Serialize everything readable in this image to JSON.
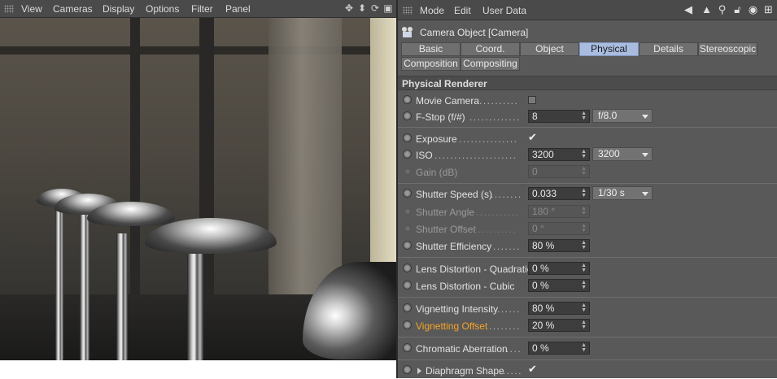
{
  "viewport": {
    "menu": [
      "View",
      "Cameras",
      "Display",
      "Options",
      "Filter",
      "Panel"
    ],
    "tools": [
      "move-icon",
      "down-arrow-icon",
      "rotate-icon",
      "layout-icon"
    ]
  },
  "attributes": {
    "menu": [
      "Mode",
      "Edit",
      "User Data"
    ],
    "tools": [
      "back-arrow-icon",
      "cursor-arrow-icon",
      "search-icon",
      "lock-icon",
      "target-icon",
      "new-panel-icon"
    ],
    "object_title": "Camera Object [Camera]",
    "tabs": [
      {
        "label": "Basic",
        "active": false
      },
      {
        "label": "Coord.",
        "active": false
      },
      {
        "label": "Object",
        "active": false
      },
      {
        "label": "Physical",
        "active": true
      },
      {
        "label": "Details",
        "active": false
      },
      {
        "label": "Stereoscopic",
        "active": false
      },
      {
        "label": "Composition",
        "active": false
      },
      {
        "label": "Compositing",
        "active": false
      }
    ],
    "section": "Physical Renderer",
    "rows": {
      "movie_camera": {
        "label": "Movie Camera"
      },
      "fstop": {
        "label": "F-Stop (f/#)",
        "value": "8",
        "preset": "f/8.0"
      },
      "exposure": {
        "label": "Exposure"
      },
      "iso": {
        "label": "ISO",
        "value": "3200",
        "preset": "3200"
      },
      "gain": {
        "label": "Gain (dB)",
        "value": "0"
      },
      "shutter_speed": {
        "label": "Shutter Speed (s)",
        "value": "0.033",
        "preset": "1/30 s"
      },
      "shutter_angle": {
        "label": "Shutter Angle",
        "value": "180 °"
      },
      "shutter_offset": {
        "label": "Shutter Offset",
        "value": "0 °"
      },
      "shutter_efficiency": {
        "label": "Shutter Efficiency",
        "value": "80 %"
      },
      "lens_quadratic": {
        "label": "Lens Distortion - Quadratic",
        "value": "0 %"
      },
      "lens_cubic": {
        "label": "Lens Distortion - Cubic",
        "value": "0 %"
      },
      "vignetting_intensity": {
        "label": "Vignetting Intensity",
        "value": "80 %"
      },
      "vignetting_offset": {
        "label": "Vignetting Offset",
        "value": "20 %"
      },
      "chromatic_aberration": {
        "label": "Chromatic Aberration",
        "value": "0 %"
      },
      "diaphragm_shape": {
        "label": "Diaphragm Shape"
      }
    },
    "colors": {
      "active_tab": "#a9bce0",
      "highlight_label": "#f6a428",
      "panel_bg": "#595959"
    }
  }
}
